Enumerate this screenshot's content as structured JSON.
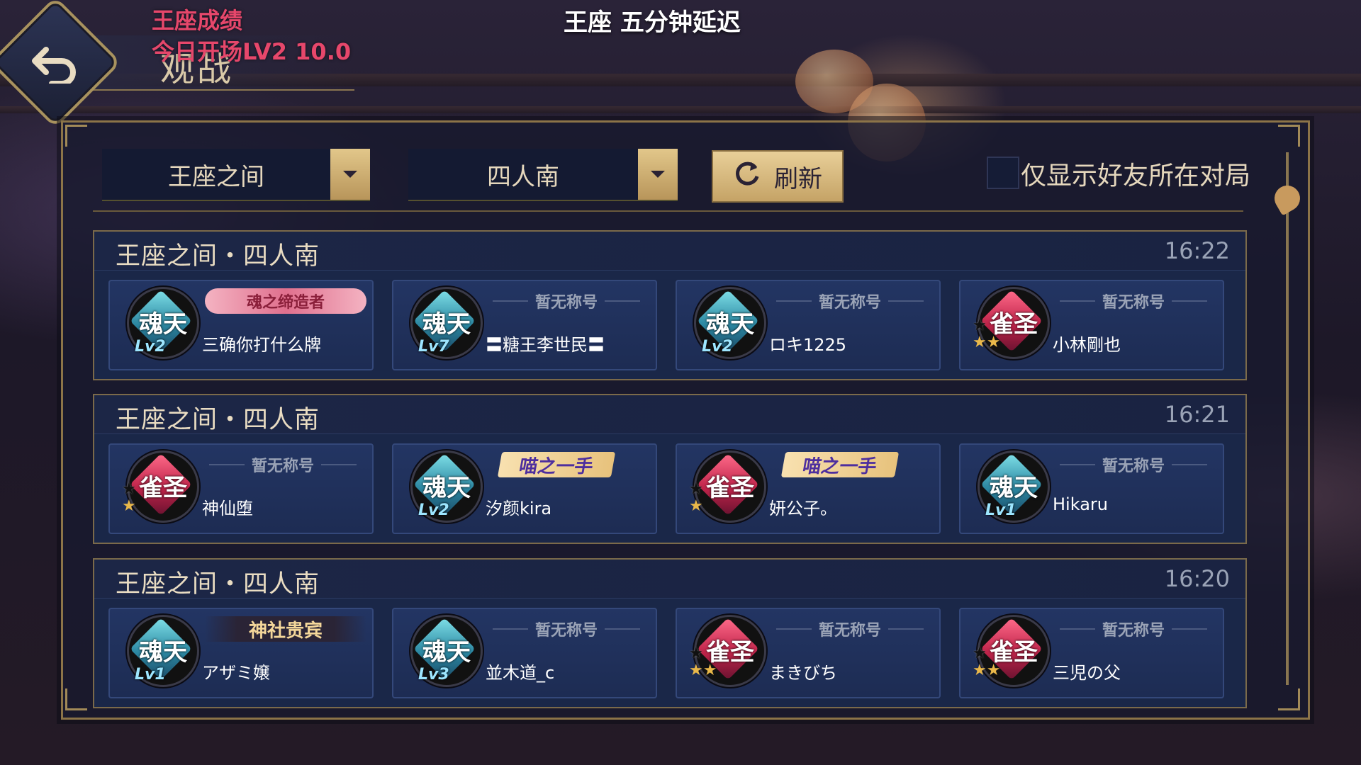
{
  "header": {
    "title": "观战",
    "back_icon": "back-arrow-icon"
  },
  "overlay": {
    "line1": "王座成绩",
    "line2": "今日开场LV2 10.0",
    "center": "王座 五分钟延迟"
  },
  "filters": {
    "room_select": "王座之间",
    "mode_select": "四人南",
    "refresh_label": "刷新",
    "friends_only_label": "仅显示好友所在对局",
    "friends_only_checked": false
  },
  "matches": [
    {
      "title": "王座之间・四人南",
      "time": "16:22",
      "players": [
        {
          "name": "三确你打什么牌",
          "rank": "魂天",
          "level": "Lv2",
          "title": "魂之缔造者",
          "title_style": "red"
        },
        {
          "name": "〓糖王李世民〓",
          "rank": "魂天",
          "level": "Lv7",
          "title": "暂无称号",
          "title_style": "none"
        },
        {
          "name": "ロキ1225",
          "rank": "魂天",
          "level": "Lv2",
          "title": "暂无称号",
          "title_style": "none"
        },
        {
          "name": "小林剛也",
          "rank": "雀圣",
          "level": "",
          "title": "暂无称号",
          "title_style": "none",
          "stars": 2
        }
      ]
    },
    {
      "title": "王座之间・四人南",
      "time": "16:21",
      "players": [
        {
          "name": "神仙堕",
          "rank": "雀圣",
          "level": "",
          "title": "暂无称号",
          "title_style": "none",
          "stars": 1
        },
        {
          "name": "汐颜kira",
          "rank": "魂天",
          "level": "Lv2",
          "title": "喵之一手",
          "title_style": "cat"
        },
        {
          "name": "妍公子。",
          "rank": "雀圣",
          "level": "",
          "title": "喵之一手",
          "title_style": "cat",
          "stars": 1
        },
        {
          "name": "Hikaru",
          "rank": "魂天",
          "level": "Lv1",
          "title": "暂无称号",
          "title_style": "none"
        }
      ]
    },
    {
      "title": "王座之间・四人南",
      "time": "16:20",
      "players": [
        {
          "name": "アザミ嬢",
          "rank": "魂天",
          "level": "Lv1",
          "title": "神社贵宾",
          "title_style": "gold"
        },
        {
          "name": "並木道_c",
          "rank": "魂天",
          "level": "Lv3",
          "title": "暂无称号",
          "title_style": "none"
        },
        {
          "name": "まきびち",
          "rank": "雀圣",
          "level": "",
          "title": "暂无称号",
          "title_style": "none",
          "stars": 2
        },
        {
          "name": "三児の父",
          "rank": "雀圣",
          "level": "",
          "title": "暂无称号",
          "title_style": "none",
          "stars": 2
        }
      ]
    }
  ],
  "colors": {
    "gold": "#c5a366",
    "panel": "#1a2748",
    "rank_hun": "#2c88a2",
    "rank_que": "#c0244a"
  }
}
